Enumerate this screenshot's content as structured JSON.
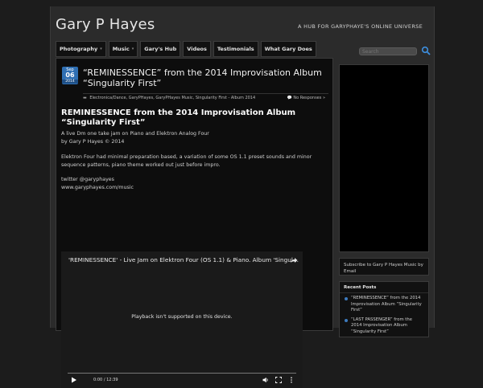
{
  "site": {
    "title": "Gary P Hayes",
    "tagline": "A HUB FOR GARYPHAYE'S ONLINE UNIVERSE"
  },
  "nav": {
    "items": [
      {
        "label": "Photography",
        "has_submenu": true
      },
      {
        "label": "Music",
        "has_submenu": true
      },
      {
        "label": "Gary's Hub",
        "has_submenu": false
      },
      {
        "label": "Videos",
        "has_submenu": false
      },
      {
        "label": "Testimonials",
        "has_submenu": false
      },
      {
        "label": "What Gary Does",
        "has_submenu": false
      }
    ],
    "submenu_marker": "▾"
  },
  "search": {
    "placeholder": "Search"
  },
  "post": {
    "date": {
      "month": "Sep",
      "day": "06",
      "year": "2014"
    },
    "header_title": "“REMINESSENCE” from the 2014 Improvisation Album “Singularity First”",
    "categories": "Electronica/Dance, GaryPHayes, GaryPHayes Music, Singularity First - Album 2014",
    "responses": "No Responses »",
    "entry_title": "REMINESSENCE from the 2014 Improvisation Album “Singularity First”",
    "para1_line1": "A live Dm one take jam on Piano and Elektron Analog Four",
    "para1_line2": "by Gary P Hayes © 2014",
    "para2": "Elektron Four had minimal preparation based, a variation of some OS 1.1 preset sounds and minor sequence patterns, piano theme worked out just before impro.",
    "para3_line1": "twitter @garyphayes",
    "para3_line2": "www.garyphayes.com/music"
  },
  "video": {
    "title": "'REMINESSENCE' - Live Jam on Elektron Four (OS 1.1) & Piano. Album 'Singul...",
    "message": "Playback isn't supported on this device.",
    "time": "0:00 / 12:39"
  },
  "sidebar": {
    "subscribe": "Subscribe to Gary P Hayes Music by Email",
    "recent_heading": "Recent Posts",
    "recent_posts": [
      "“REMINESSENCE” from the 2014 Improvisation Album “Singularity First”",
      "“LAST PASSENGER” from the 2014 Improvisation Album “Singularity First”"
    ]
  },
  "colors": {
    "accent": "#2f6fb3",
    "background": "#1c1c1c",
    "panel": "#2b2b2b"
  }
}
